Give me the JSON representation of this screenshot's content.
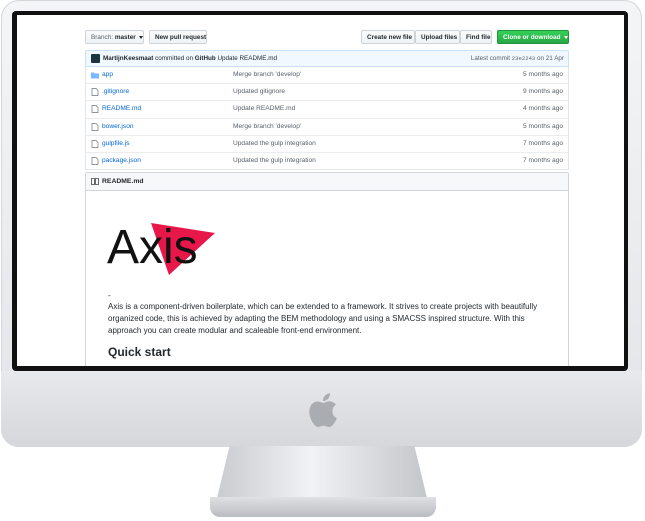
{
  "toolbar": {
    "branch_prefix": "Branch:",
    "branch_name": "master",
    "new_pull_request": "New pull request",
    "create_new_file": "Create new file",
    "upload_files": "Upload files",
    "find_file": "Find file",
    "clone_or_download": "Clone or download"
  },
  "commit": {
    "author": "MartijnKeesmaat",
    "committed_on": "committed on",
    "platform": "GitHub",
    "message": "Update README.md",
    "latest_label": "Latest commit",
    "sha": "23e2243",
    "date": "on 21 Apr"
  },
  "files": [
    {
      "name": "app",
      "type": "folder",
      "message": "Merge branch 'develop'",
      "age": "5 months ago"
    },
    {
      "name": ".gitignore",
      "type": "file",
      "message": "Updated gitignore",
      "age": "9 months ago"
    },
    {
      "name": "README.md",
      "type": "file",
      "message": "Update README.md",
      "age": "4 months ago"
    },
    {
      "name": "bower.json",
      "type": "file",
      "message": "Merge branch 'develop'",
      "age": "5 months ago"
    },
    {
      "name": "gulpfile.js",
      "type": "file",
      "message": "Updated the gulp integration",
      "age": "7 months ago"
    },
    {
      "name": "package.json",
      "type": "file",
      "message": "Updated the gulp integration",
      "age": "7 months ago"
    }
  ],
  "readme": {
    "title": "README.md",
    "logo_text": "Axis",
    "dash": "-",
    "description": "Axis is a component-driven boilerplate, which can be extended to a framework. It strives to create projects with beautifully organized code, this is achieved by adapting the BEM methodology and using a SMACSS inspired structure. With this approach you can create modular and scaleable front-end environment.",
    "quick_start": "Quick start"
  },
  "colors": {
    "link": "#0366d6",
    "green_button": "#28a745",
    "logo_triangle": "#e8174a",
    "commit_bar_bg": "#f1f8ff"
  },
  "icons": {
    "folder": "folder-icon",
    "file": "file-icon",
    "book": "book-icon",
    "apple": "apple-logo-icon"
  }
}
